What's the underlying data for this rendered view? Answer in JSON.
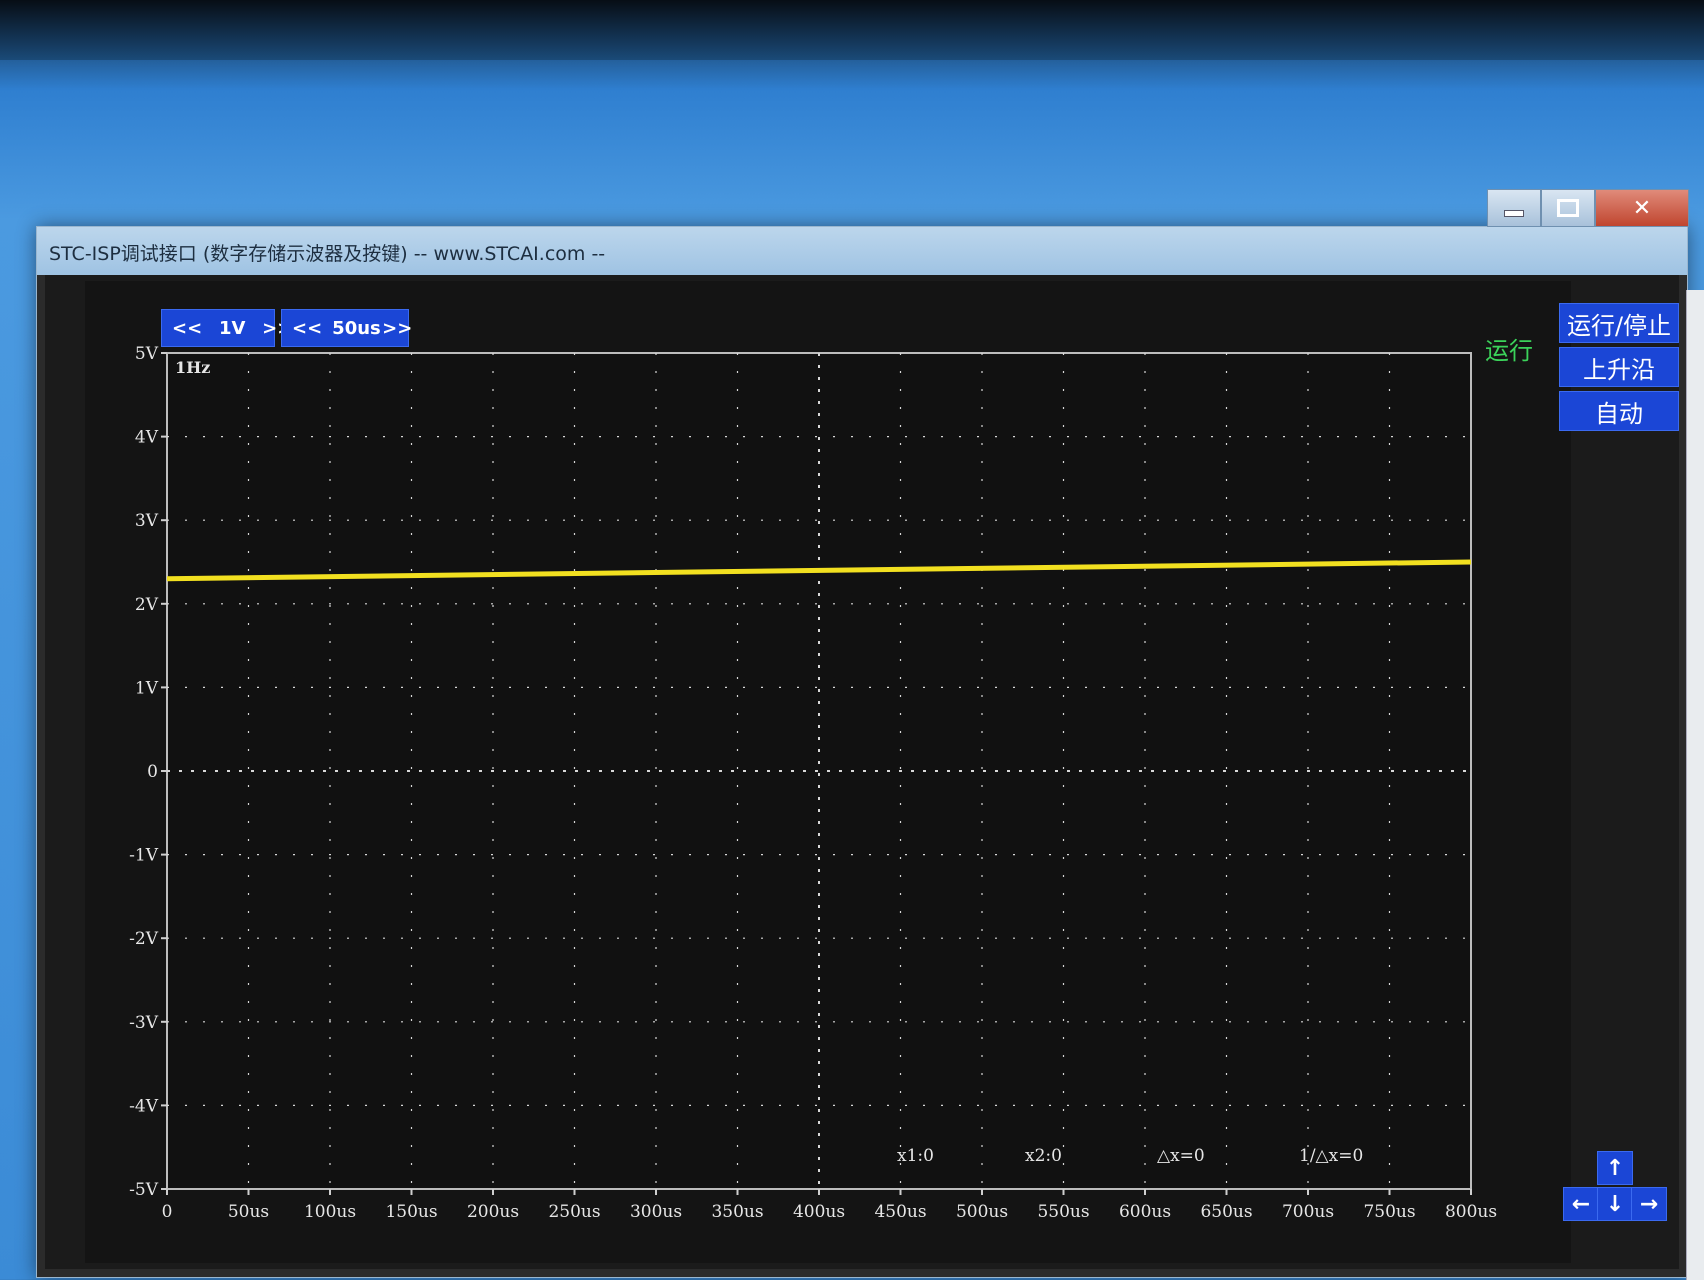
{
  "window": {
    "title": "STC-ISP调试接口 (数字存储示波器及按键) -- www.STCAI.com --"
  },
  "controls": {
    "volt_div": "1V",
    "time_div": "50us",
    "prev_label": "<<",
    "next_label": ">>"
  },
  "status": "运行",
  "side_buttons": {
    "run_stop": "运行/停止",
    "rising_edge": "上升沿",
    "auto": "自动"
  },
  "nav": {
    "up": "↑",
    "left": "←",
    "down": "↓",
    "right": "→"
  },
  "chart_data": {
    "type": "line",
    "frequency_label": "1Hz",
    "y_ticks": [
      "5V",
      "4V",
      "3V",
      "2V",
      "1V",
      "0",
      "-1V",
      "-2V",
      "-3V",
      "-4V",
      "-5V"
    ],
    "x_ticks": [
      "0",
      "50us",
      "100us",
      "150us",
      "200us",
      "250us",
      "300us",
      "350us",
      "400us",
      "450us",
      "500us",
      "550us",
      "600us",
      "650us",
      "700us",
      "750us",
      "800us"
    ],
    "ylim": [
      -5,
      5
    ],
    "xlim": [
      0,
      800
    ],
    "series": [
      {
        "color": "#f2e020",
        "x": [
          0,
          800
        ],
        "y": [
          2.3,
          2.5
        ]
      }
    ],
    "cursors": {
      "x1": "x1:0",
      "x2": "x2:0",
      "dx": "△x=0",
      "inv_dx": "1/△x=0"
    },
    "grid": true
  }
}
